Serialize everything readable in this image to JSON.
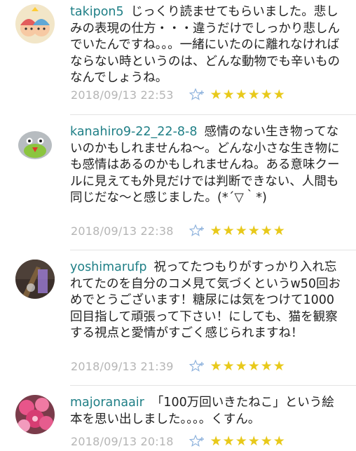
{
  "comments": [
    {
      "username": "takipon5",
      "text": "じっくり読ませてもらいました。悲しみの表現の仕方・・・違うだけでしっかり悲しんでいたんですね。。。一緒にいたのに離れなければならない時というのは、どんな動物でも辛いものなんでしょうね。",
      "date": "2018/09/13 22:53",
      "stars": "★★★★★★"
    },
    {
      "username": "kanahiro9-22_22-8-8",
      "text": "感情のない生き物ってないのかもしれませんね〜。どんな小さな生き物にも感情はあるのかもしれませんね。ある意味クールに見えても外見だけでは判断できない、人間も同じだな〜と感じました。(*´▽｀*)",
      "date": "2018/09/13 22:38",
      "stars": "★★★★★★"
    },
    {
      "username": "yoshimarufp",
      "text": "祝ってたつもりがすっかり入れ忘れてたのを自分のコメ見て気づくというw50回おめでとうございます！糖尿には気をつけて1000回目指して頑張って下さい！にしても、猫を観察する視点と愛情がすごく感じられますね！",
      "date": "2018/09/13 21:39",
      "stars": "★★★★★★"
    },
    {
      "username": "majoranaair",
      "text": "「100万回いきたねこ」という絵本を思い出しました。。。。くすん。",
      "date": "2018/09/13 20:18",
      "stars": "★★★★★★"
    }
  ],
  "colors": {
    "username": "#1f7f86",
    "date": "#b5b5b5",
    "stars": "#e8c91a",
    "favorite_icon": "#8fb3dd"
  },
  "icons": {
    "favorite": "star-plus-icon"
  }
}
